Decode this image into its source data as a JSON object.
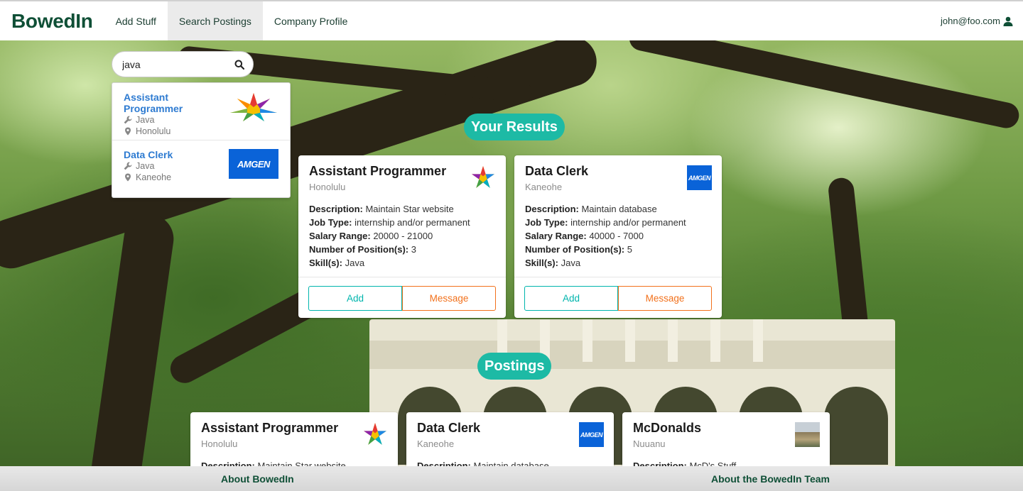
{
  "brand": "BowedIn",
  "nav": {
    "items": [
      "Add Stuff",
      "Search Postings",
      "Company Profile"
    ],
    "active": "Search Postings",
    "user": "john@foo.com"
  },
  "search": {
    "value": "java",
    "results": [
      {
        "title": "Assistant Programmer",
        "skill": "Java",
        "location": "Honolulu",
        "logo": "star-logo"
      },
      {
        "title": "Data Clerk",
        "skill": "Java",
        "location": "Kaneohe",
        "logo": "amgen-logo"
      }
    ]
  },
  "sections": {
    "results_title": "Your Results",
    "postings_title": "Postings"
  },
  "labels": {
    "description": "Description:",
    "job_type": "Job Type:",
    "salary": "Salary Range:",
    "positions": "Number of Position(s):",
    "skills": "Skill(s):",
    "add": "Add",
    "message": "Message"
  },
  "result_cards": [
    {
      "title": "Assistant Programmer",
      "location": "Honolulu",
      "description": "Maintain Star website",
      "job_type": "internship and/or permanent",
      "salary": "20000 - 21000",
      "positions": "3",
      "skills": "Java",
      "logo": "star-logo"
    },
    {
      "title": "Data Clerk",
      "location": "Kaneohe",
      "description": "Maintain database",
      "job_type": "internship and/or permanent",
      "salary": "40000 - 7000",
      "positions": "5",
      "skills": "Java",
      "logo": "amgen-logo"
    }
  ],
  "posting_cards": [
    {
      "title": "Assistant Programmer",
      "location": "Honolulu",
      "description": "Maintain Star website",
      "logo": "star-logo"
    },
    {
      "title": "Data Clerk",
      "location": "Kaneohe",
      "description": "Maintain database",
      "logo": "amgen-logo"
    },
    {
      "title": "McDonalds",
      "location": "Nuuanu",
      "description": "McD's Stuff",
      "logo": "storefront-photo"
    }
  ],
  "amgen_text": "AMGEN",
  "footer": {
    "about": "About BowedIn",
    "team": "About the BowedIn Team"
  },
  "colors": {
    "brand": "#0f4f36",
    "teal": "#1dbaa5",
    "orange": "#f2711c",
    "link": "#2e7bd1",
    "amgen": "#0a63d8"
  }
}
